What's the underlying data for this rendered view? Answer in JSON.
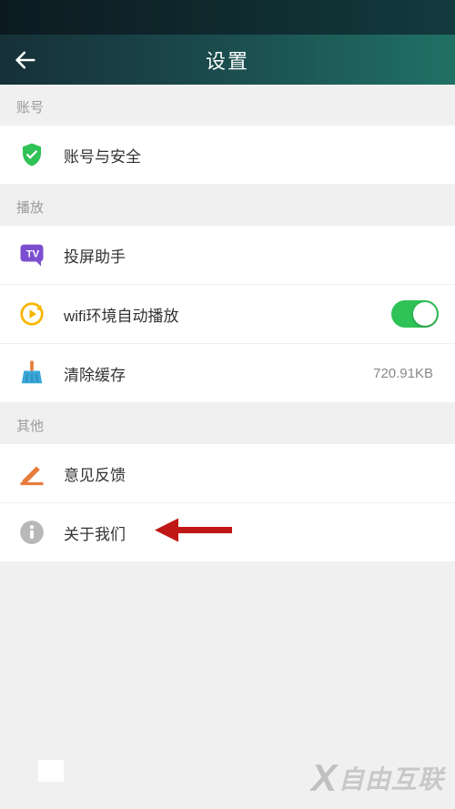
{
  "header": {
    "title": "设置"
  },
  "sections": {
    "account": {
      "header": "账号",
      "item_security": "账号与安全"
    },
    "playback": {
      "header": "播放",
      "item_cast": "投屏助手",
      "item_wifi_auto": "wifi环境自动播放",
      "item_clear_cache": "清除缓存",
      "cache_size": "720.91KB"
    },
    "other": {
      "header": "其他",
      "item_feedback": "意见反馈",
      "item_about": "关于我们"
    }
  },
  "watermark": "自由互联",
  "colors": {
    "toggle_on": "#2fc256",
    "icon_shield": "#2fc256",
    "icon_cast": "#7b4fcf",
    "icon_play": "#f7b500",
    "icon_broom_handle": "#e77c3c",
    "icon_broom_body": "#3aa7d9",
    "icon_pen": "#e77c3c",
    "icon_info": "#b8b8b8"
  }
}
